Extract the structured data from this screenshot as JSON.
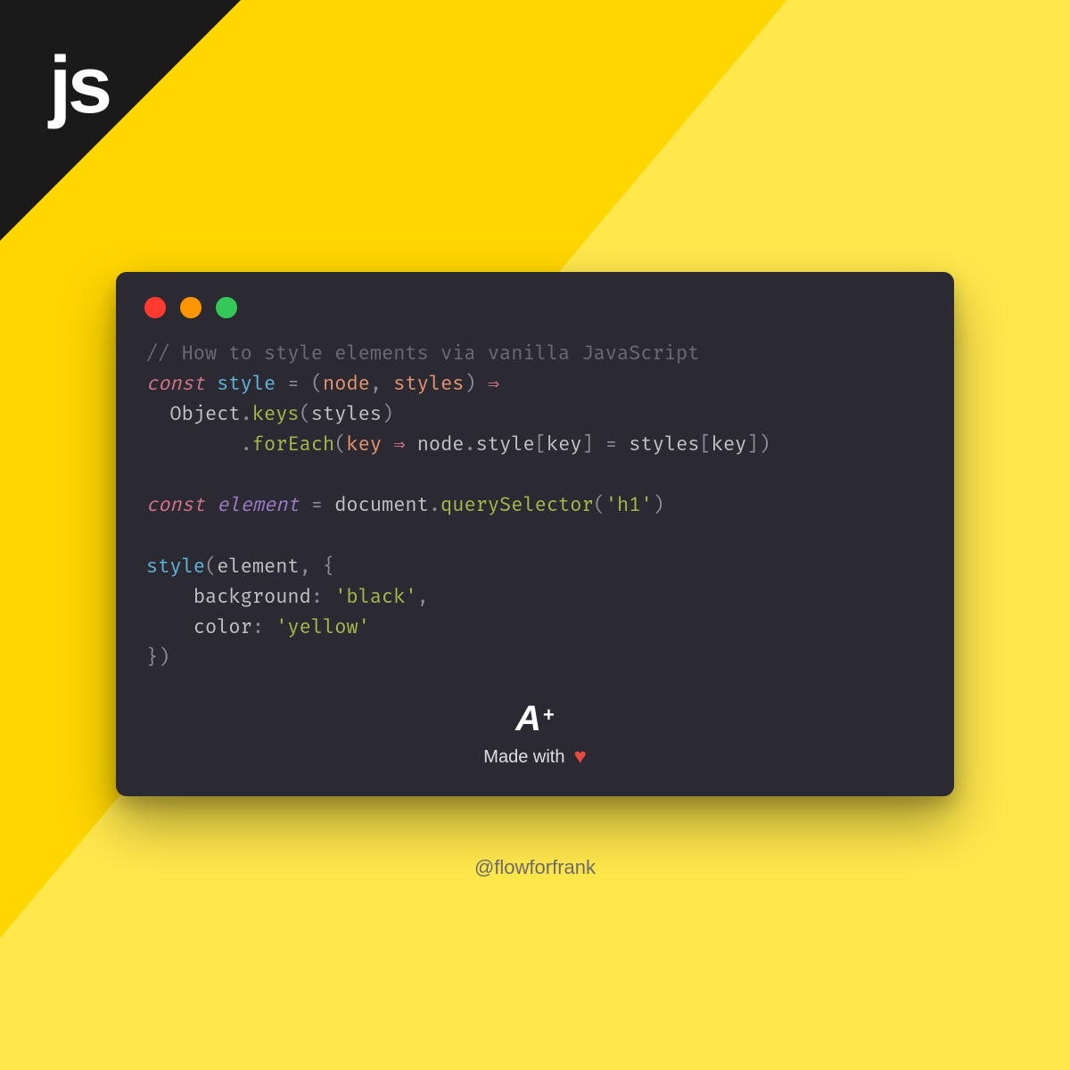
{
  "badge": {
    "label": "js"
  },
  "window": {
    "dots": {
      "red": "red",
      "yellow": "yellow",
      "green": "green"
    }
  },
  "code": {
    "t_comment": "// How to style elements via vanilla JavaScript",
    "t_const1": "const",
    "t_style": "style",
    "t_eq": " = ",
    "t_lp": "(",
    "t_node": "node",
    "t_comma": ", ",
    "t_styles": "styles",
    "t_rp": ")",
    "t_arrow": " ⇒",
    "t_object": "Object",
    "t_dot": ".",
    "t_keys": "keys",
    "t_foreach": "forEach",
    "t_key": "key",
    "t_stylep": "style",
    "t_lbrk": "[",
    "t_rbrk": "]",
    "t_assign": " = ",
    "t_const2": "const",
    "t_element": "element",
    "t_document": "document",
    "t_qsel": "querySelector",
    "t_strh1": "'h1'",
    "t_lbrace": "{",
    "t_rbrace": "}",
    "t_background": "background",
    "t_colon": ": ",
    "t_strblack": "'black'",
    "t_commaend": ",",
    "t_color": "color",
    "t_stryellow": "'yellow'",
    "indent1": "  ",
    "indent2": "        ",
    "indent3": "    "
  },
  "footer": {
    "logo_letter": "A",
    "logo_plus": "+",
    "made_with": "Made with",
    "heart": "♥"
  },
  "attribution": {
    "handle": "@flowforfrank"
  }
}
